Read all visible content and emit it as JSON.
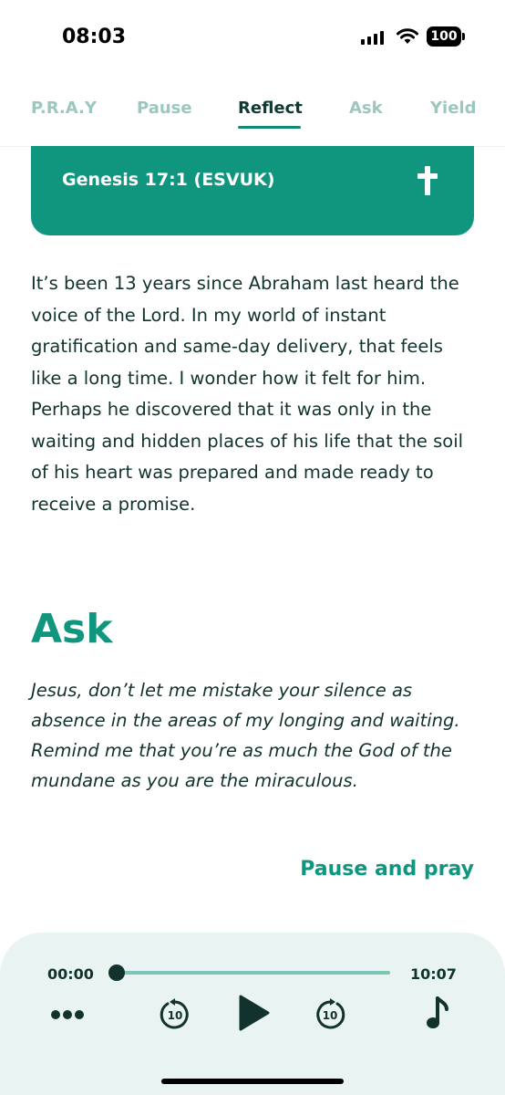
{
  "status_bar": {
    "time": "08:03",
    "battery": "100"
  },
  "tabs": [
    {
      "label": "P.R.A.Y",
      "active": false
    },
    {
      "label": "Pause",
      "active": false
    },
    {
      "label": "Reflect",
      "active": true
    },
    {
      "label": "Ask",
      "active": false
    },
    {
      "label": "Yield",
      "active": false
    }
  ],
  "scripture": {
    "reference": "Genesis 17:1 (ESVUK)",
    "icon": "cross-icon"
  },
  "reflection_text": "It’s been 13 years since Abraham last heard the voice of the Lord. In my world of instant gratification and same-day delivery, that feels like a long time. I wonder how it felt for him. Perhaps he discovered that it was only in the waiting and hidden places of his life that the soil of his heart was prepared and made ready to receive a promise.",
  "ask": {
    "heading": "Ask",
    "prayer": "Jesus, don’t let me mistake your silence as absence in the areas of my longing and waiting. Remind me that you’re as much the God of the mundane as you are the miraculous.",
    "link": "Pause and pray"
  },
  "player": {
    "current_time": "00:00",
    "duration": "10:07",
    "progress": 0,
    "skip_seconds": "10"
  },
  "colors": {
    "accent": "#10967f",
    "text": "#12332d",
    "tab_inactive": "#9cc7bf",
    "player_bg": "#e9f3f1"
  }
}
